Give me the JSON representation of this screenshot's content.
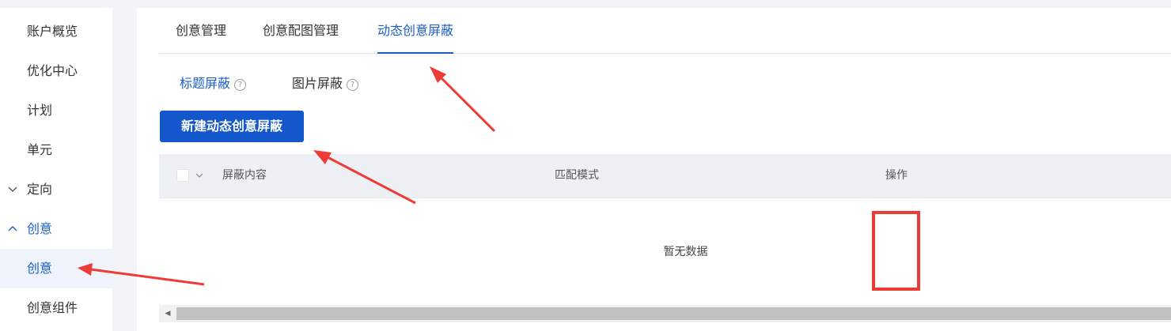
{
  "sidebar": {
    "items": [
      {
        "label": "账户概览"
      },
      {
        "label": "优化中心"
      },
      {
        "label": "计划"
      },
      {
        "label": "单元"
      },
      {
        "label": "定向",
        "chevron": "chevron-down"
      },
      {
        "label": "创意",
        "chevron": "chevron-up"
      },
      {
        "label": "创意",
        "active": true
      },
      {
        "label": "创意组件"
      }
    ]
  },
  "tabs": [
    {
      "label": "创意管理"
    },
    {
      "label": "创意配图管理"
    },
    {
      "label": "动态创意屏蔽",
      "active": true
    }
  ],
  "subtabs": [
    {
      "label": "标题屏蔽",
      "active": true,
      "icon": "help-icon"
    },
    {
      "label": "图片屏蔽",
      "icon": "help-icon"
    }
  ],
  "primary_button": {
    "label": "新建动态创意屏蔽"
  },
  "table": {
    "columns": [
      "屏蔽内容",
      "匹配模式",
      "操作"
    ],
    "empty_text": "暂无数据"
  },
  "colors": {
    "accent": "#1b5ec6",
    "button": "#1457cc",
    "annotation": "#ef3b36"
  }
}
